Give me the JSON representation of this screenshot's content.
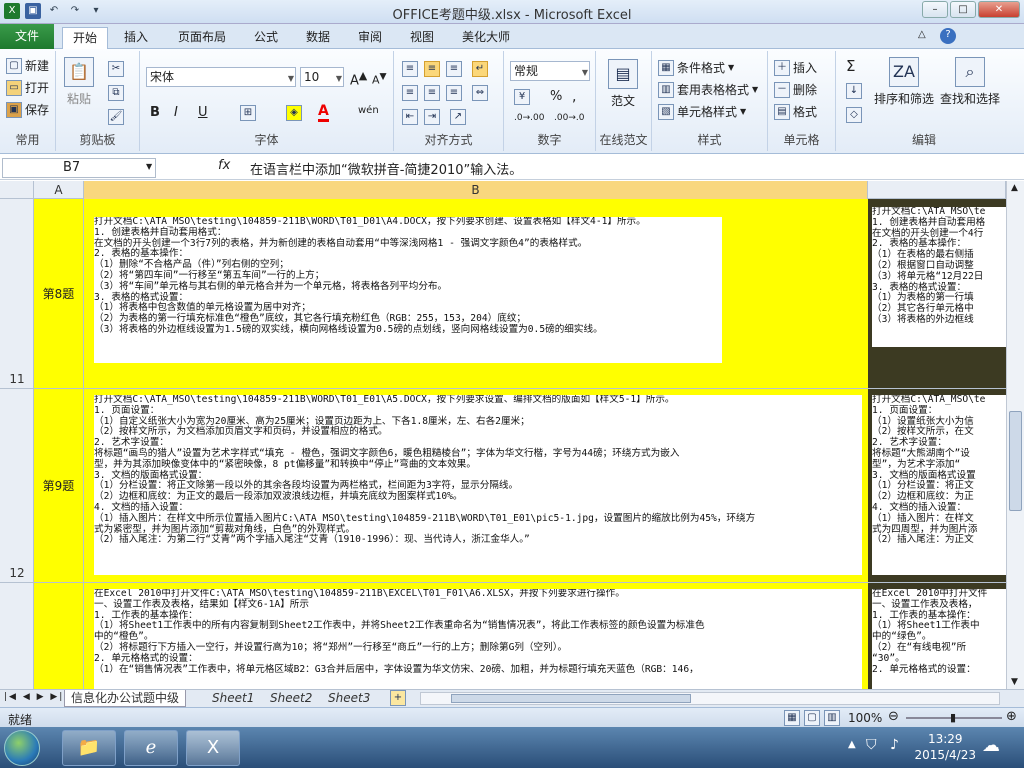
{
  "window": {
    "title": "OFFICE考题中级.xlsx - Microsoft Excel",
    "min": "–",
    "max": "□",
    "close": "✕"
  },
  "tabs": [
    "文件",
    "开始",
    "插入",
    "页面布局",
    "公式",
    "数据",
    "审阅",
    "视图",
    "美化大师"
  ],
  "ribbon": {
    "common": {
      "new": "新建",
      "open": "打开",
      "save": "保存",
      "label": "常用"
    },
    "clipboard": {
      "paste": "粘贴",
      "label": "剪贴板"
    },
    "font": {
      "name": "宋体",
      "size": "10",
      "bold": "B",
      "italic": "I",
      "underline": "U",
      "label": "字体"
    },
    "align": {
      "label": "对齐方式"
    },
    "number": {
      "format": "常规",
      "label": "数字"
    },
    "online": {
      "fanwen": "范文",
      "label": "在线范文"
    },
    "styles": {
      "cond": "条件格式",
      "table": "套用表格格式",
      "cell": "单元格样式",
      "label": "样式"
    },
    "cells": {
      "insert": "插入",
      "delete": "删除",
      "format": "格式",
      "label": "单元格"
    },
    "editing": {
      "sort": "排序和筛选",
      "find": "查找和选择",
      "label": "编辑"
    }
  },
  "formula": {
    "name": "B7",
    "fx": "fx",
    "content": "在语言栏中添加“微软拼音-简捷2010”输入法。"
  },
  "columns": {
    "a": "A",
    "b": "B"
  },
  "rows": [
    {
      "num": "11",
      "label": "第8题",
      "text": "打开文档C:\\ATA_MSO\\testing\\104859-211B\\WORD\\T01_D01\\A4.DOCX，按下列要求创建、设置表格如【样文4-1】所示。\n1. 创建表格并自动套用格式：\n在文档的开头创建一个3行7列的表格，并为新创建的表格自动套用“中等深浅网格1 - 强调文字颜色4”的表格样式。\n2. 表格的基本操作：\n（1）删除“不合格产品（件）”列右侧的空列；\n（2）将“第四车间”一行移至“第五车间”一行的上方；\n（3）将“车间”单元格与其右侧的单元格合并为一个单元格，将表格各列平均分布。\n3. 表格的格式设置：\n（1）将表格中包含数值的单元格设置为居中对齐；\n（2）为表格的第一行填充标准色“橙色”底纹，其它各行填充粉红色（RGB：255，153，204）底纹；\n（3）将表格的外边框线设置为1.5磅的双实线，横向网格线设置为0.5磅的点划线，竖向网格线设置为0.5磅的细实线。",
      "side": "打开文档C:\\ATA_MSO\\te\n1. 创建表格并自动套用格\n在文档的开头创建一个4行\n2. 表格的基本操作：\n（1）在表格的最右侧插\n（2）根据窗口自动调整\n（3）将单元格“12月22日\n3. 表格的格式设置：\n（1）为表格的第一行填\n（2）其它各行单元格中\n（3）将表格的外边框线"
    },
    {
      "num": "12",
      "label": "第9题",
      "text": "打开文档C:\\ATA_MSO\\testing\\104859-211B\\WORD\\T01_E01\\A5.DOCX，按下列要求设置、编排文档的版面如【样文5-1】所示。\n1. 页面设置：\n（1）自定义纸张大小为宽为20厘米、高为25厘米；设置页边距为上、下各1.8厘米，左、右各2厘米；\n（2）按样文所示，为文档添加页眉文字和页码，并设置相应的格式。\n2. 艺术字设置：\n将标题“画鸟的猎人”设置为艺术字样式“填充 - 橙色，强调文字颜色6，暖色粗糙棱台”；字体为华文行楷，字号为44磅；环绕方式为嵌入\n型，并为其添加映像变体中的“紧密映像，8 pt偏移量”和转换中“停止”弯曲的文本效果。\n3. 文档的版面格式设置：\n（1）分栏设置：将正文除第一段以外的其余各段均设置为两栏格式，栏间距为3字符，显示分隔线。\n（2）边框和底纹：为正文的最后一段添加双波浪线边框，并填充底纹为图案样式10%。\n4. 文档的插入设置：\n（1）插入图片：在样文中所示位置插入图片C:\\ATA_MSO\\testing\\104859-211B\\WORD\\T01_E01\\pic5-1.jpg，设置图片的缩放比例为45%，环绕方\n式为紧密型，并为图片添加“剪裁对角线，白色”的外观样式。\n（2）插入尾注：为第二行“艾青”两个字插入尾注“艾青（1910-1996）：现、当代诗人，浙江金华人。”",
      "side": "打开文档C:\\ATA_MSO\\te\n1. 页面设置：\n（1）设置纸张大小为信\n（2）按样文所示，在文\n2. 艺术字设置：\n将标题“大熊湖南个”设\n型”，为艺术字添加“\n3. 文档的版面格式设置\n（1）分栏设置：将正文\n（2）边框和底纹：为正\n4. 文档的插入设置：\n（1）插入图片：在样文\n式为四周型，并为图片添\n（2）插入尾注：为正文"
    },
    {
      "num": "",
      "label": "",
      "text": "在Excel 2010中打开文件C:\\ATA_MSO\\testing\\104859-211B\\EXCEL\\T01_F01\\A6.XLSX，并按下列要求进行操作。\n一、设置工作表及表格，结果如【样文6-1A】所示\n1. 工作表的基本操作：\n（1）将Sheet1工作表中的所有内容复制到Sheet2工作表中，并将Sheet2工作表重命名为“销售情况表”，将此工作表标签的颜色设置为标准色\n中的“橙色”。\n（2）将标题行下方插入一空行，并设置行高为10；将“郑州”一行移至“商丘”一行的上方；删除第G列（空列）。\n2. 单元格格式的设置：\n（1）在“销售情况表”工作表中，将单元格区域B2：G3合并后居中，字体设置为华文仿宋、20磅、加粗，并为标题行填充天蓝色（RGB：146，",
      "side": "在Excel 2010中打开文件\n一、设置工作表及表格，\n1. 工作表的基本操作：\n（1）将Sheet1工作表中\n中的“绿色”。\n（2）在“有线电视”所\n“30”。\n2. 单元格格式的设置："
    }
  ],
  "sheets": {
    "active": "信息化办公试题中级",
    "s1": "Sheet1",
    "s2": "Sheet2",
    "s3": "Sheet3"
  },
  "status": {
    "ready": "就绪",
    "zoom": "100%"
  },
  "clock": {
    "time": "13:29",
    "date": "2015/4/23"
  }
}
